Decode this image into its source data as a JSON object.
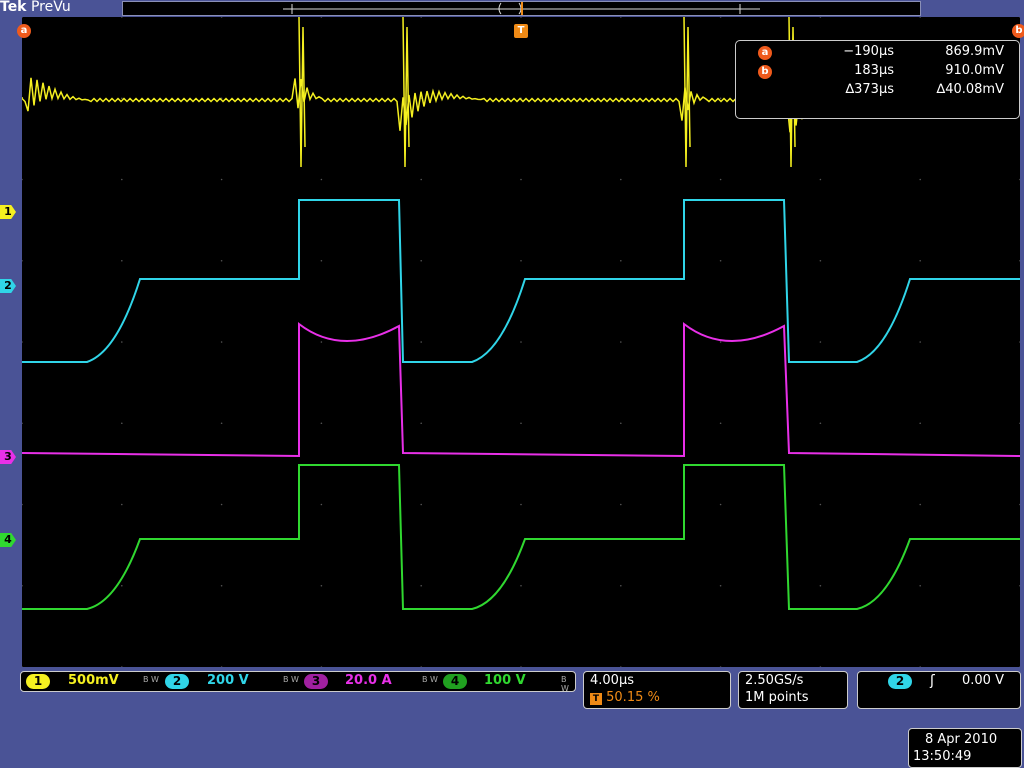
{
  "header": {
    "brand": "Tek",
    "mode": "PreVu"
  },
  "markers": {
    "cursor_a": "a",
    "cursor_b": "b",
    "trigger": "T",
    "ch1": "1",
    "ch2": "2",
    "ch3": "3",
    "ch4": "4"
  },
  "cursor_readout": {
    "a": {
      "label": "a",
      "time": "−190µs",
      "value": "869.9mV"
    },
    "b": {
      "label": "b",
      "time": "183µs",
      "value": "910.0mV"
    },
    "delta": {
      "time": "∆373µs",
      "value": "∆40.08mV"
    }
  },
  "channels": [
    {
      "id": "1",
      "scale": "500mV",
      "color": "#f5f020",
      "bw": "B W"
    },
    {
      "id": "2",
      "scale": "200 V",
      "color": "#30d5e8",
      "bw": "B W"
    },
    {
      "id": "3",
      "scale": "20.0 A",
      "color": "#e830e8",
      "bw": "B W"
    },
    {
      "id": "4",
      "scale": "100 V",
      "color": "#30d830",
      "bw": "B W"
    }
  ],
  "timebase": {
    "per_div": "4.00µs",
    "trigger_badge": "T",
    "trigger_pos": "50.15 %"
  },
  "acquisition": {
    "sample_rate": "2.50GS/s",
    "record_length": "1M points"
  },
  "trigger": {
    "source": "2",
    "slope": "ʃ",
    "level": "0.00 V"
  },
  "datetime": {
    "date": "8 Apr 2010",
    "time": "13:50:49"
  },
  "colors": {
    "ch1": "#f5f020",
    "ch2": "#30d5e8",
    "ch3": "#e830e8",
    "ch4": "#30d830",
    "cursor": "#ef5a1c",
    "trigger": "#ef8a16",
    "frame": "#4a5396"
  }
}
